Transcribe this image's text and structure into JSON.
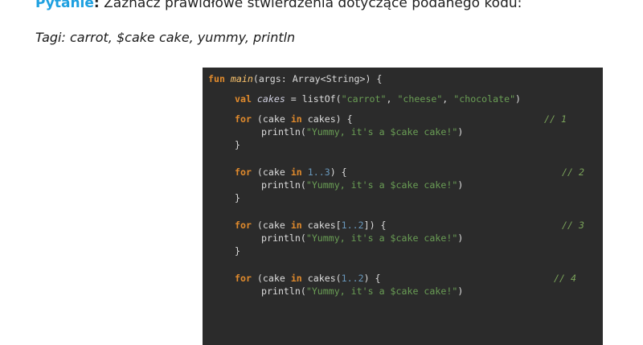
{
  "question": {
    "label": "Pytanie",
    "colon": ":",
    "text": " Zaznacz prawidłowe stwierdzenia dotyczące podanego kodu:"
  },
  "tags": {
    "text": "Tagi: carrot, $cake cake, yummy, println"
  },
  "code": {
    "line1": {
      "kw": "fun ",
      "fn": "main",
      "rest": "(args: Array<String>) {"
    },
    "line2": {
      "kw": "val ",
      "var": "cakes",
      "mid": " = listOf(",
      "s1": "\"carrot\"",
      "c1": ", ",
      "s2": "\"cheese\"",
      "c2": ", ",
      "s3": "\"chocolate\"",
      "end": ")"
    },
    "block1": {
      "kw_for": "for",
      "open": " (cake ",
      "kw_in": "in",
      "expr": " cakes) {",
      "comment": "// 1",
      "print_fn": "println(",
      "print_str": "\"Yummy, it's a $cake cake!\"",
      "print_end": ")",
      "close": "}"
    },
    "block2": {
      "kw_for": "for",
      "open": " (cake ",
      "kw_in": "in",
      "num": " 1..3",
      "expr_end": ") {",
      "comment": "// 2",
      "print_fn": "println(",
      "print_str": "\"Yummy, it's a $cake cake!\"",
      "print_end": ")",
      "close": "}"
    },
    "block3": {
      "kw_for": "for",
      "open": " (cake ",
      "kw_in": "in",
      "expr_a": " cakes[",
      "num": "1..2",
      "expr_b": "]) {",
      "comment": "// 3",
      "print_fn": "println(",
      "print_str": "\"Yummy, it's a $cake cake!\"",
      "print_end": ")",
      "close": "}"
    },
    "block4": {
      "kw_for": "for",
      "open": " (cake ",
      "kw_in": "in",
      "expr_a": " cakes(",
      "num": "1..2",
      "expr_b": ") {",
      "comment": "// 4",
      "print_fn": "println(",
      "print_str": "\"Yummy, it's a $cake cake!\"",
      "print_end": ")"
    }
  },
  "colors": {
    "question_label": "#1ea0e0",
    "code_background": "#2b2b2b",
    "keyword": "#e08a2c",
    "string": "#6a9e55",
    "comment": "#7aa35a"
  }
}
